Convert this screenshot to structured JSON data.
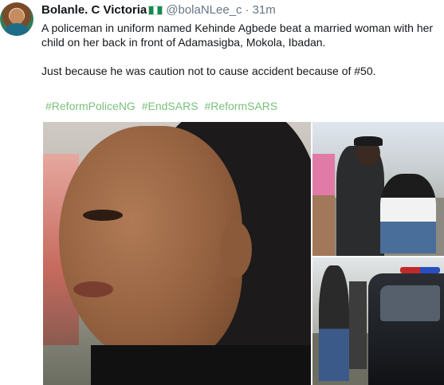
{
  "tweet": {
    "author_name": "Bolanle. C Victoria",
    "handle": "@bolaNLee_c",
    "separator": "·",
    "time": "31m",
    "paragraph1": "A policeman in uniform named Kehinde Agbede beat a married woman with her child on her back in front of Adamasigba, Mokola, Ibadan.",
    "paragraph2": "Just because he was caution not to cause accident because of #50.",
    "hashtags": [
      "#ReformPoliceNG",
      "#EndSARS",
      "#ReformSARS"
    ],
    "hashtag_color": "#7bc07b"
  },
  "icons": {
    "avatar": "profile-avatar",
    "flag": "nigeria-flag-emoji"
  }
}
